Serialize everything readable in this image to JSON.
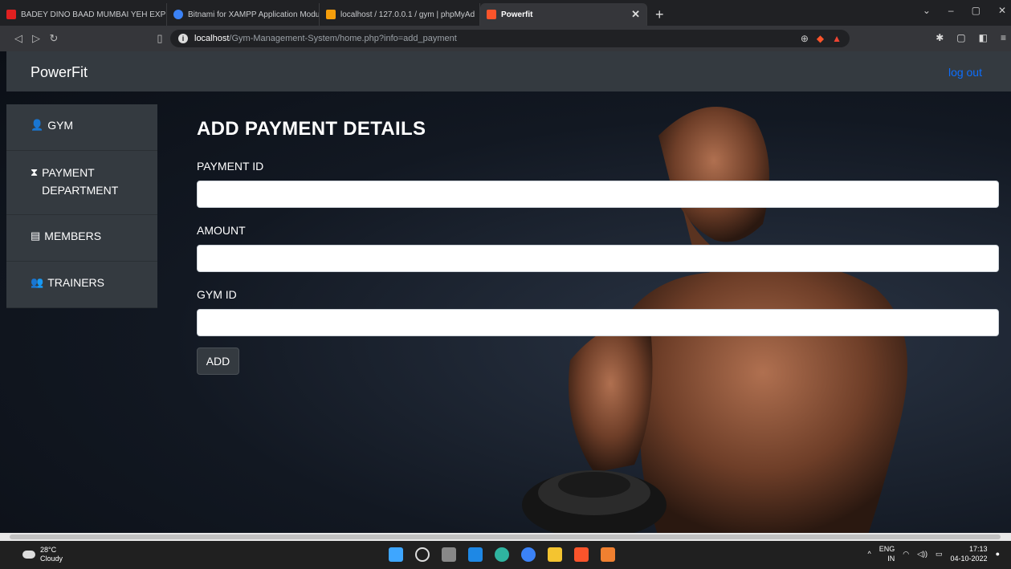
{
  "browser": {
    "tabs": [
      {
        "title": "BADEY DINO BAAD MUMBAI YEH EXP",
        "color": "#e02020"
      },
      {
        "title": "Bitnami for XAMPP Application Modu",
        "color": "#3b82f6"
      },
      {
        "title": "localhost / 127.0.0.1 / gym | phpMyAd",
        "color": "#f59e0b"
      },
      {
        "title": "Powerfit",
        "color": "#fb542b"
      }
    ],
    "active_tab_index": 3,
    "url_host": "localhost",
    "url_path": "/Gym-Management-System/home.php?info=add_payment"
  },
  "app": {
    "brand": "PowerFit",
    "logout_label": "log out",
    "sidebar": [
      {
        "label": "GYM",
        "icon": "user-icon"
      },
      {
        "label": "PAYMENT DEPARTMENT",
        "icon": "payment-icon"
      },
      {
        "label": "MEMBERS",
        "icon": "list-icon"
      },
      {
        "label": "TRAINERS",
        "icon": "users-icon"
      }
    ],
    "form": {
      "title": "ADD PAYMENT DETAILS",
      "fields": [
        {
          "label": "PAYMENT ID",
          "value": ""
        },
        {
          "label": "AMOUNT",
          "value": ""
        },
        {
          "label": "GYM ID",
          "value": ""
        }
      ],
      "submit_label": "ADD"
    },
    "colors": {
      "navbar": "#343a40",
      "link": "#0d6efd"
    }
  },
  "taskbar": {
    "temperature": "28°C",
    "weather": "Cloudy",
    "lang": "ENG",
    "region": "IN",
    "time": "17:13",
    "date": "04-10-2022"
  }
}
